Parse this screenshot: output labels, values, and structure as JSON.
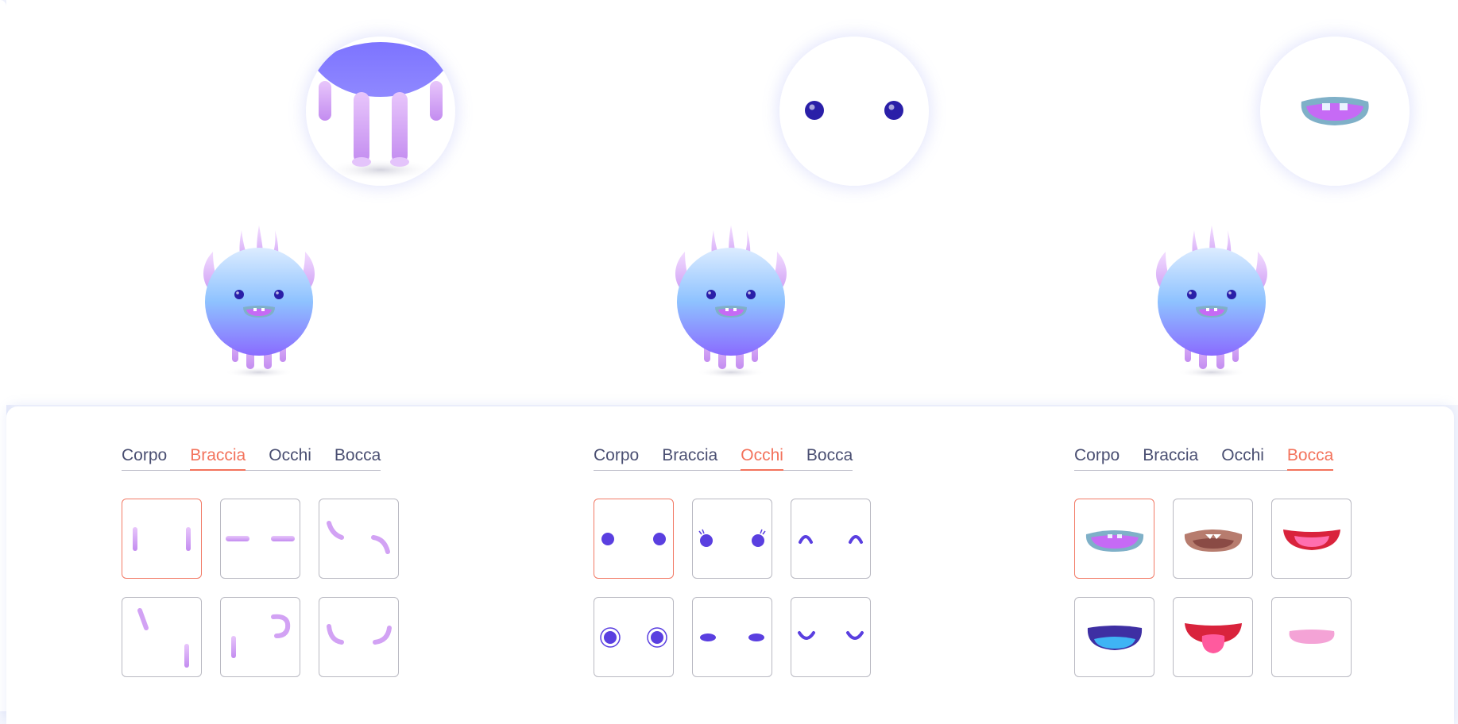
{
  "columns": [
    {
      "preview_part": "arms-legs",
      "tabs": [
        {
          "label": "Corpo",
          "active": false
        },
        {
          "label": "Braccia",
          "active": true
        },
        {
          "label": "Occhi",
          "active": false
        },
        {
          "label": "Bocca",
          "active": false
        }
      ],
      "options": [
        "arms-vertical",
        "arms-horizontal",
        "arms-curved",
        "arms-diagonal",
        "arms-bent",
        "arms-cupped"
      ],
      "selected_index": 0
    },
    {
      "preview_part": "eyes",
      "tabs": [
        {
          "label": "Corpo",
          "active": false
        },
        {
          "label": "Braccia",
          "active": false
        },
        {
          "label": "Occhi",
          "active": true
        },
        {
          "label": "Bocca",
          "active": false
        }
      ],
      "options": [
        "eyes-dots",
        "eyes-lashes",
        "eyes-arch",
        "eyes-ringed",
        "eyes-narrow",
        "eyes-smile"
      ],
      "selected_index": 0
    },
    {
      "preview_part": "mouth",
      "tabs": [
        {
          "label": "Corpo",
          "active": false
        },
        {
          "label": "Braccia",
          "active": false
        },
        {
          "label": "Occhi",
          "active": false
        },
        {
          "label": "Bocca",
          "active": true
        }
      ],
      "options": [
        "mouth-purple-teeth",
        "mouth-brown-teeth",
        "mouth-red-open",
        "mouth-navy-blue",
        "mouth-red-tongue",
        "mouth-pink-closed"
      ],
      "selected_index": 0
    }
  ],
  "colors": {
    "accent": "#f3735c",
    "tab_text": "#4a4f72",
    "body_top": "#dbeaff",
    "body_bottom": "#8a6cff",
    "limb": "#d7a8f6",
    "eye": "#2a1fa8"
  }
}
